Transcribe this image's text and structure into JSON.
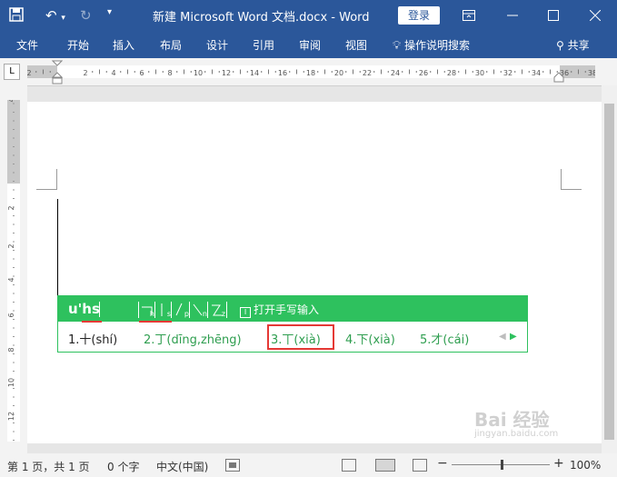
{
  "titlebar": {
    "title": "新建 Microsoft Word 文档.docx  -  Word",
    "login": "登录",
    "colors": {
      "bg": "#2b579a"
    }
  },
  "ribbon": {
    "tabs": [
      "文件",
      "开始",
      "插入",
      "布局",
      "设计",
      "引用",
      "审阅",
      "视图"
    ],
    "search": "操作说明搜索",
    "share": "共享"
  },
  "ruler": {
    "h_labels": [
      "2",
      "2",
      "4",
      "6",
      "8",
      "10",
      "12",
      "14",
      "16",
      "18",
      "20",
      "22",
      "24",
      "26",
      "28",
      "30",
      "32",
      "34",
      "36",
      "38"
    ],
    "v_labels": [
      "4",
      "2",
      "2",
      "4",
      "6",
      "8",
      "10",
      "12"
    ]
  },
  "ime": {
    "input": "u'hs",
    "strokes": [
      "h",
      "s",
      "p",
      "n",
      "z"
    ],
    "handwrite": "打开手写输入",
    "candidates": [
      "1.十(shí)",
      "2.丁(dīng,zhēng)",
      "3.丅(xià)",
      "4.下(xià)",
      "5.才(cái)"
    ],
    "accent": "#2ec15e",
    "highlight": "#e53935"
  },
  "status": {
    "page": "第 1 页，共 1 页",
    "words": "0 个字",
    "lang": "中文(中国)",
    "zoom": "100%"
  },
  "watermark": {
    "text": "Bai 经验",
    "sub": "jingyan.baidu.com"
  }
}
